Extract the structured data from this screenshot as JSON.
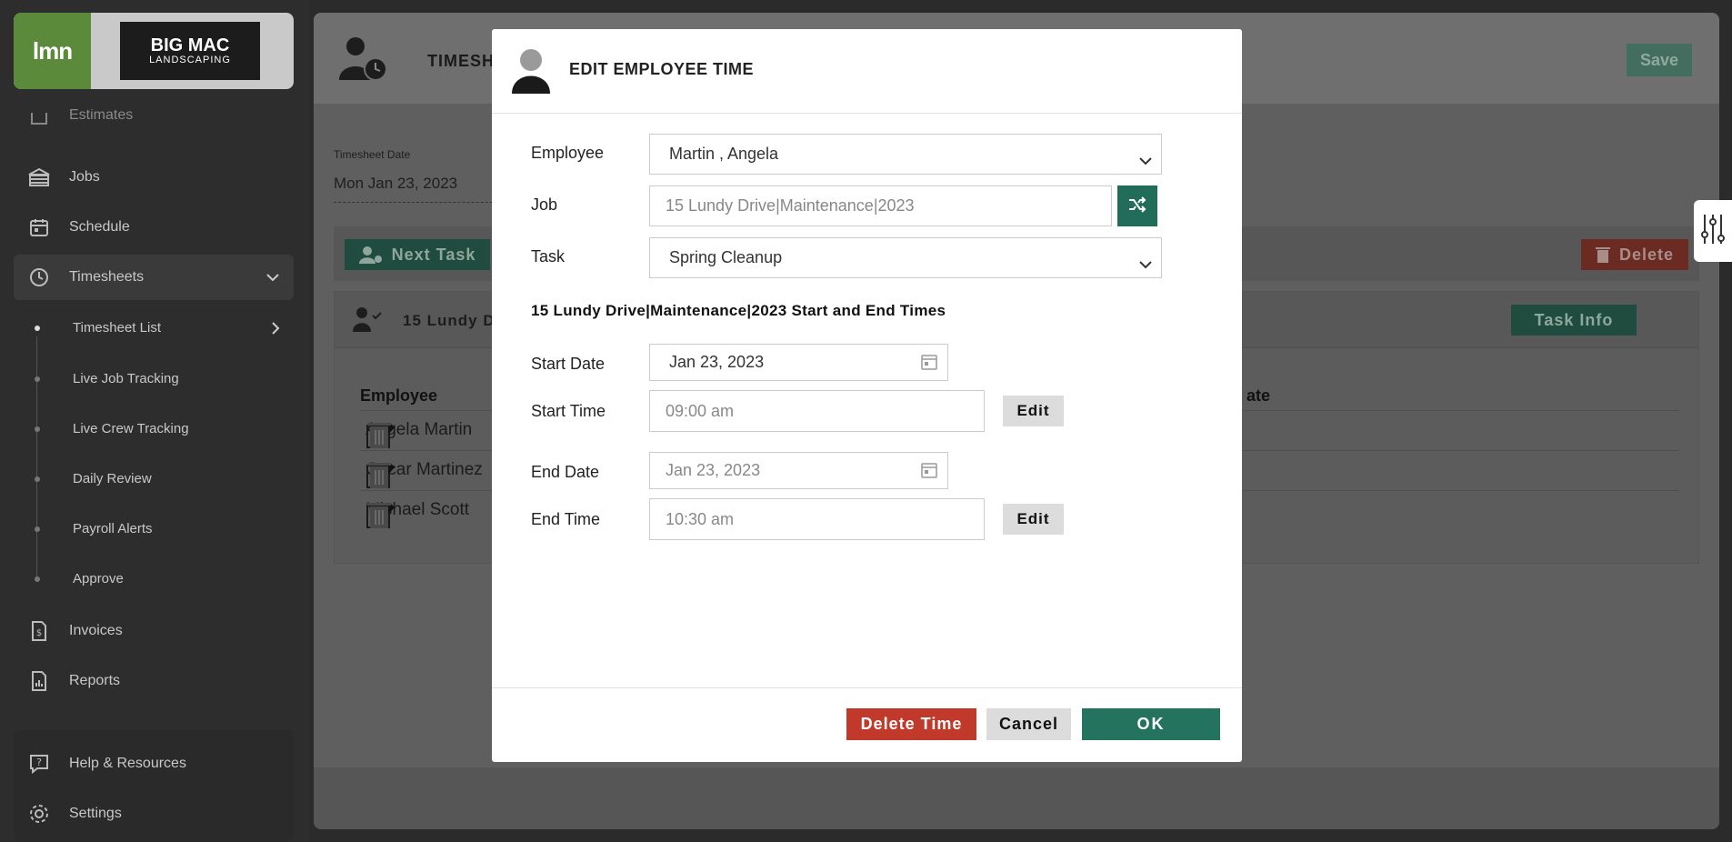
{
  "sidebar": {
    "brand": {
      "lmn": "lmn",
      "bigmac_top": "BIG MAC",
      "bigmac_bottom": "LANDSCAPING"
    },
    "partial_item": "Estimates",
    "items": [
      {
        "label": "Jobs",
        "icon": "jobs-icon"
      },
      {
        "label": "Schedule",
        "icon": "calendar-icon"
      },
      {
        "label": "Timesheets",
        "icon": "clock-icon"
      },
      {
        "label": "Invoices",
        "icon": "invoice-icon"
      },
      {
        "label": "Reports",
        "icon": "reports-icon"
      }
    ],
    "sub_items": [
      {
        "label": "Timesheet List"
      },
      {
        "label": "Live Job Tracking"
      },
      {
        "label": "Live Crew Tracking"
      },
      {
        "label": "Daily Review"
      },
      {
        "label": "Payroll Alerts"
      },
      {
        "label": "Approve"
      }
    ],
    "bottom_items": [
      {
        "label": "Help & Resources",
        "icon": "help-icon"
      },
      {
        "label": "Settings",
        "icon": "gear-icon"
      }
    ]
  },
  "main": {
    "header_title": "TIMESH",
    "save_label": "Save",
    "timesheet_date_label": "Timesheet Date",
    "timesheet_date_value": "Mon Jan 23, 2023",
    "next_task_label": "Next Task",
    "delete_label": "Delete",
    "task_name": "15 Lundy D",
    "task_info_label": "Task Info",
    "col_employee": "Employee",
    "col_date_partial": "ate",
    "employees": [
      "Angela Martin",
      "Oscar Martinez",
      "Michael Scott"
    ]
  },
  "modal": {
    "title": "EDIT EMPLOYEE TIME",
    "employee_label": "Employee",
    "employee_value": "Martin , Angela",
    "job_label": "Job",
    "job_value": "15 Lundy Drive|Maintenance|2023",
    "task_label": "Task",
    "task_value": "Spring Cleanup",
    "section_title": "15 Lundy Drive|Maintenance|2023 Start and End Times",
    "start_date_label": "Start Date",
    "start_date_value": "Jan 23, 2023",
    "start_time_label": "Start Time",
    "start_time_value": "09:00 am",
    "end_date_label": "End Date",
    "end_date_value": "Jan 23, 2023",
    "end_time_label": "End Time",
    "end_time_value": "10:30 am",
    "edit_label": "Edit",
    "delete_time_label": "Delete Time",
    "cancel_label": "Cancel",
    "ok_label": "OK"
  },
  "colors": {
    "primary_green": "#23735f",
    "danger_red": "#c0392b",
    "sidebar_bg": "#2d2d2d",
    "lmn_green": "#5a8a3a"
  }
}
